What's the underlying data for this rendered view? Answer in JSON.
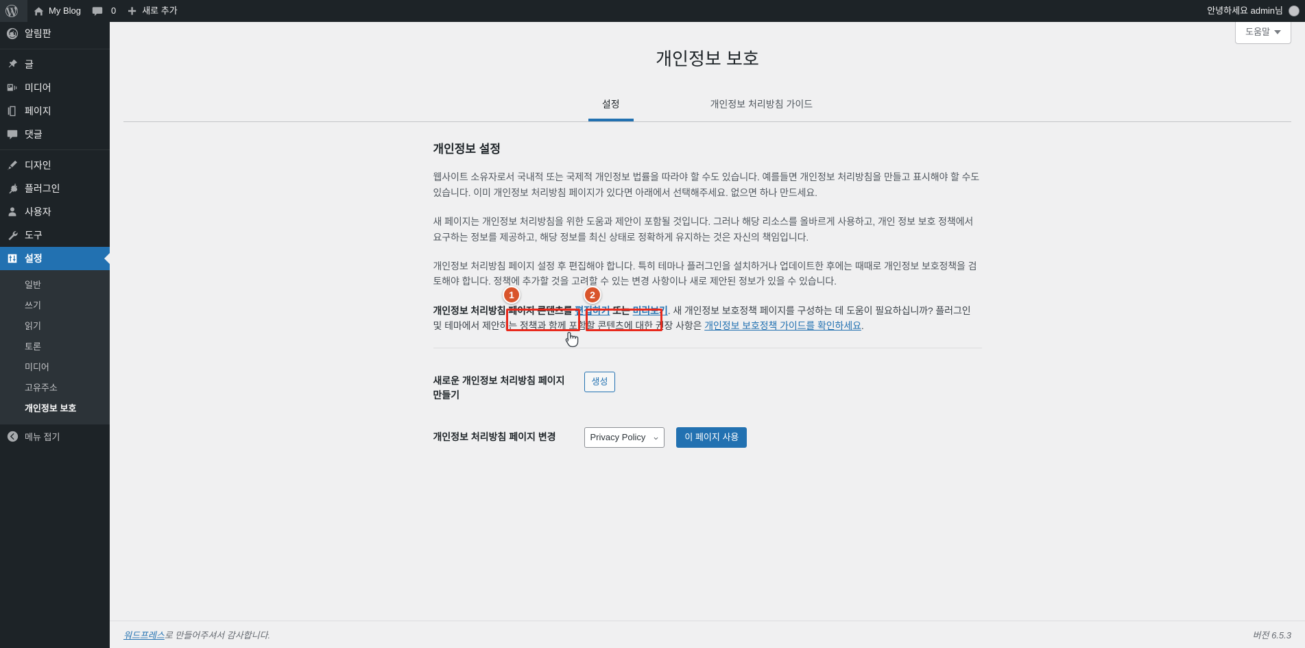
{
  "adminbar": {
    "wp_logo": "wordpress-logo-icon",
    "site_name": "My Blog",
    "comments_count": "0",
    "new_label": "새로 추가",
    "howdy": "안녕하세요 admin님"
  },
  "sidebar": {
    "items": [
      {
        "label": "알림판",
        "icon": "dashboard-icon",
        "current": false
      },
      {
        "label": "글",
        "icon": "pin-icon",
        "current": false
      },
      {
        "label": "미디어",
        "icon": "media-icon",
        "current": false
      },
      {
        "label": "페이지",
        "icon": "page-icon",
        "current": false
      },
      {
        "label": "댓글",
        "icon": "comment-icon",
        "current": false
      },
      {
        "label": "디자인",
        "icon": "appearance-brush-icon",
        "current": false
      },
      {
        "label": "플러그인",
        "icon": "plugin-icon",
        "current": false
      },
      {
        "label": "사용자",
        "icon": "users-icon",
        "current": false
      },
      {
        "label": "도구",
        "icon": "tools-wrench-icon",
        "current": false
      },
      {
        "label": "설정",
        "icon": "settings-sliders-icon",
        "current": true
      }
    ],
    "submenu": [
      {
        "label": "일반",
        "current": false
      },
      {
        "label": "쓰기",
        "current": false
      },
      {
        "label": "읽기",
        "current": false
      },
      {
        "label": "토론",
        "current": false
      },
      {
        "label": "미디어",
        "current": false
      },
      {
        "label": "고유주소",
        "current": false
      },
      {
        "label": "개인정보 보호",
        "current": true
      }
    ],
    "collapse_label": "메뉴 접기"
  },
  "screen_meta": {
    "help_label": "도움말"
  },
  "page": {
    "title": "개인정보 보호",
    "tabs": [
      {
        "label": "설정",
        "active": true
      },
      {
        "label": "개인정보 처리방침 가이드",
        "active": false
      }
    ],
    "section_heading": "개인정보 설정",
    "paragraphs": [
      "웹사이트 소유자로서 국내적 또는 국제적 개인정보 법률을 따라야 할 수도 있습니다. 예를들면 개인정보 처리방침을 만들고 표시해야 할 수도 있습니다. 이미 개인정보 처리방침 페이지가 있다면 아래에서 선택해주세요. 없으면 하나 만드세요.",
      "새 페이지는 개인정보 처리방침을 위한 도움과 제안이 포함될 것입니다. 그러나 해당 리소스를 올바르게 사용하고, 개인 정보 보호 정책에서 요구하는 정보를 제공하고, 해당 정보를 최신 상태로 정확하게 유지하는 것은 자신의 책임입니다.",
      "개인정보 처리방침 페이지 설정 후 편집해야 합니다. 특히 테마나 플러그인을 설치하거나 업데이트한 후에는 때때로 개인정보 보호정책을 검토해야 합니다. 정책에 추가할 것을 고려할 수 있는 변경 사항이나 새로 제안된 정보가 있을 수 있습니다."
    ],
    "policy_line": {
      "lead": "개인정보 처리방침 페이지 콘텐츠를 ",
      "edit_link": "편집하기",
      "or": " 또는 ",
      "preview_link": "미리보기",
      "mid": ". 새 개인정보 보호정책 페이지를 구성하는 데 도움이 필요하십니까? 플러그인 및 테마에서 제안하는 정책과 함께 포함할 콘텐츠에 대한 권장 사항은 ",
      "guide_link": "개인정보 보호정책 가이드를 확인하세요",
      "tail": "."
    },
    "form": {
      "create_row_label": "새로운 개인정보 처리방침 페이지 만들기",
      "create_button": "생성",
      "change_row_label": "개인정보 처리방침 페이지 변경",
      "select_value": "Privacy Policy",
      "select_options": [
        "Privacy Policy"
      ],
      "use_page_button": "이 페이지 사용"
    },
    "annotations": [
      {
        "step": "1",
        "target": "page-select"
      },
      {
        "step": "2",
        "target": "use-page-button"
      }
    ]
  },
  "footer": {
    "thanks_link": "워드프레스",
    "thanks_rest": "로 만들어주셔서 감사합니다.",
    "version": "버전 6.5.3"
  },
  "colors": {
    "sidebar_bg": "#1d2327",
    "submenu_bg": "#2c3338",
    "accent_blue": "#2271b1",
    "content_bg": "#f0f0f1",
    "highlight_red": "#e8291c",
    "badge_orange": "#d9542b"
  }
}
